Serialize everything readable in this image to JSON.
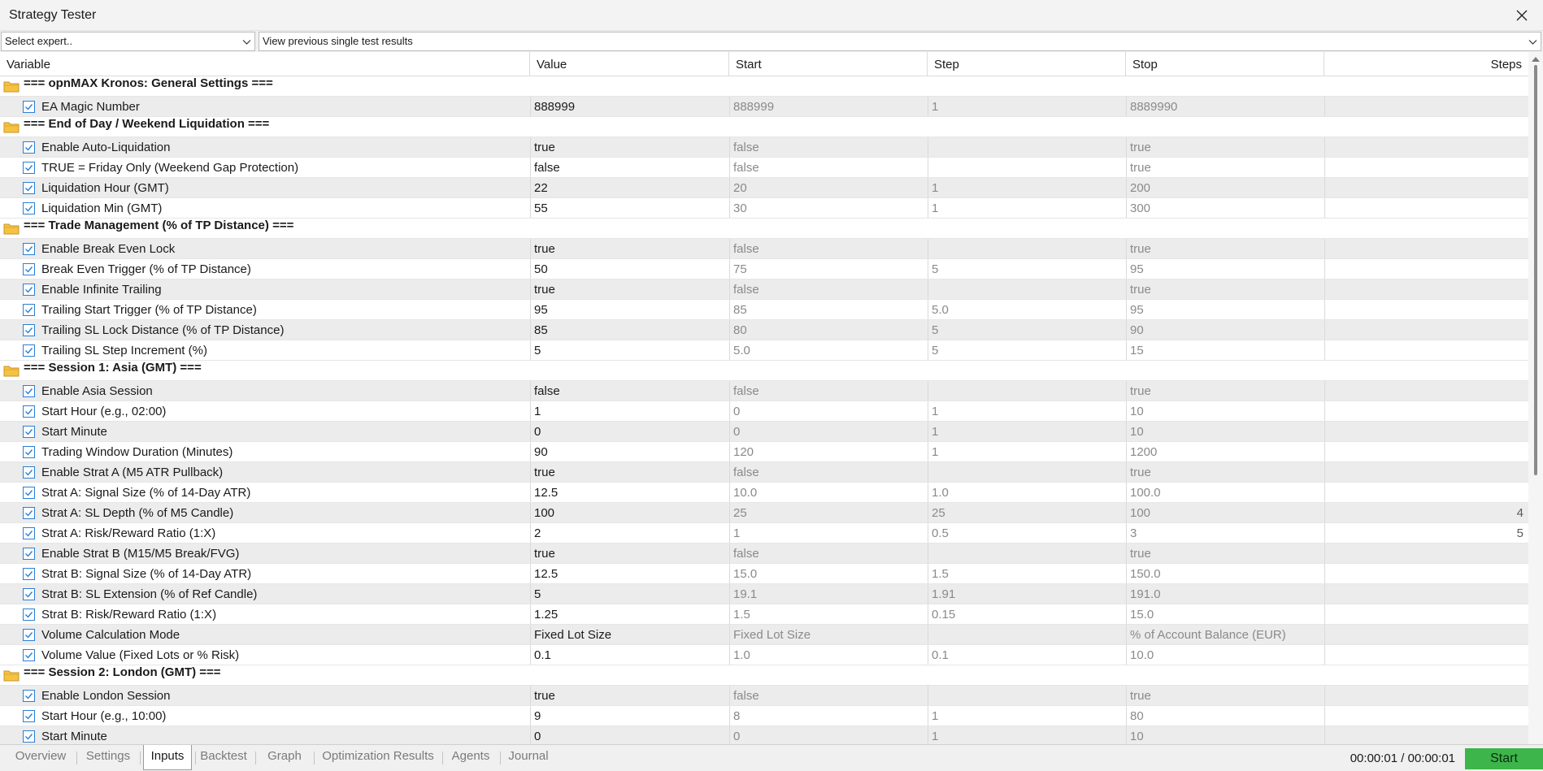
{
  "window": {
    "title": "Strategy Tester"
  },
  "toolbar": {
    "expert_value": "Select expert..",
    "history_value": "View previous single test results"
  },
  "columns": {
    "variable": "Variable",
    "value": "Value",
    "start": "Start",
    "step": "Step",
    "stop": "Stop",
    "steps": "Steps"
  },
  "rows": [
    {
      "type": "group",
      "label": "=== opnMAX Kronos: General Settings ==="
    },
    {
      "type": "param",
      "name": "EA Magic Number",
      "value": "888999",
      "start": "888999",
      "step": "1",
      "stop": "8889990",
      "steps": ""
    },
    {
      "type": "group",
      "label": "=== End of Day / Weekend Liquidation ==="
    },
    {
      "type": "param",
      "name": "Enable Auto-Liquidation",
      "value": "true",
      "start": "false",
      "step": "",
      "stop": "true",
      "steps": ""
    },
    {
      "type": "param",
      "name": "TRUE = Friday Only (Weekend Gap Protection)",
      "value": "false",
      "start": "false",
      "step": "",
      "stop": "true",
      "steps": ""
    },
    {
      "type": "param",
      "name": "Liquidation Hour (GMT)",
      "value": "22",
      "start": "20",
      "step": "1",
      "stop": "200",
      "steps": ""
    },
    {
      "type": "param",
      "name": "Liquidation Min (GMT)",
      "value": "55",
      "start": "30",
      "step": "1",
      "stop": "300",
      "steps": ""
    },
    {
      "type": "group",
      "label": "=== Trade Management (% of TP Distance) ==="
    },
    {
      "type": "param",
      "name": "Enable Break Even Lock",
      "value": "true",
      "start": "false",
      "step": "",
      "stop": "true",
      "steps": ""
    },
    {
      "type": "param",
      "name": "Break Even Trigger (% of TP Distance)",
      "value": "50",
      "start": "75",
      "step": "5",
      "stop": "95",
      "steps": ""
    },
    {
      "type": "param",
      "name": "Enable Infinite Trailing",
      "value": "true",
      "start": "false",
      "step": "",
      "stop": "true",
      "steps": ""
    },
    {
      "type": "param",
      "name": "Trailing Start Trigger (% of TP Distance)",
      "value": "95",
      "start": "85",
      "step": "5.0",
      "stop": "95",
      "steps": ""
    },
    {
      "type": "param",
      "name": "Trailing SL Lock Distance (% of TP Distance)",
      "value": "85",
      "start": "80",
      "step": "5",
      "stop": "90",
      "steps": ""
    },
    {
      "type": "param",
      "name": "Trailing SL Step Increment (%)",
      "value": "5",
      "start": "5.0",
      "step": "5",
      "stop": "15",
      "steps": ""
    },
    {
      "type": "group",
      "label": "=== Session 1: Asia (GMT) ==="
    },
    {
      "type": "param",
      "name": "Enable Asia Session",
      "value": "false",
      "start": "false",
      "step": "",
      "stop": "true",
      "steps": ""
    },
    {
      "type": "param",
      "name": "Start Hour (e.g., 02:00)",
      "value": "1",
      "start": "0",
      "step": "1",
      "stop": "10",
      "steps": ""
    },
    {
      "type": "param",
      "name": "Start Minute",
      "value": "0",
      "start": "0",
      "step": "1",
      "stop": "10",
      "steps": ""
    },
    {
      "type": "param",
      "name": "Trading Window Duration (Minutes)",
      "value": "90",
      "start": "120",
      "step": "1",
      "stop": "1200",
      "steps": ""
    },
    {
      "type": "param",
      "name": "Enable Strat A (M5 ATR Pullback)",
      "value": "true",
      "start": "false",
      "step": "",
      "stop": "true",
      "steps": ""
    },
    {
      "type": "param",
      "name": "Strat A: Signal Size (% of 14-Day ATR)",
      "value": "12.5",
      "start": "10.0",
      "step": "1.0",
      "stop": "100.0",
      "steps": ""
    },
    {
      "type": "param",
      "name": "Strat A: SL Depth (% of M5 Candle)",
      "value": "100",
      "start": "25",
      "step": "25",
      "stop": "100",
      "steps": "4"
    },
    {
      "type": "param",
      "name": "Strat A: Risk/Reward Ratio (1:X)",
      "value": "2",
      "start": "1",
      "step": "0.5",
      "stop": "3",
      "steps": "5"
    },
    {
      "type": "param",
      "name": "Enable Strat B (M15/M5 Break/FVG)",
      "value": "true",
      "start": "false",
      "step": "",
      "stop": "true",
      "steps": ""
    },
    {
      "type": "param",
      "name": "Strat B: Signal Size (% of 14-Day ATR)",
      "value": "12.5",
      "start": "15.0",
      "step": "1.5",
      "stop": "150.0",
      "steps": ""
    },
    {
      "type": "param",
      "name": "Strat B: SL Extension (% of Ref Candle)",
      "value": "5",
      "start": "19.1",
      "step": "1.91",
      "stop": "191.0",
      "steps": ""
    },
    {
      "type": "param",
      "name": "Strat B: Risk/Reward Ratio (1:X)",
      "value": "1.25",
      "start": "1.5",
      "step": "0.15",
      "stop": "15.0",
      "steps": ""
    },
    {
      "type": "param",
      "name": "Volume Calculation Mode",
      "value": "Fixed Lot Size",
      "start": "Fixed Lot Size",
      "step": "",
      "stop": "% of Account Balance (EUR)",
      "steps": ""
    },
    {
      "type": "param",
      "name": "Volume Value (Fixed Lots or % Risk)",
      "value": "0.1",
      "start": "1.0",
      "step": "0.1",
      "stop": "10.0",
      "steps": ""
    },
    {
      "type": "group",
      "label": "=== Session 2: London (GMT) ==="
    },
    {
      "type": "param",
      "name": "Enable London Session",
      "value": "true",
      "start": "false",
      "step": "",
      "stop": "true",
      "steps": ""
    },
    {
      "type": "param",
      "name": "Start Hour (e.g., 10:00)",
      "value": "9",
      "start": "8",
      "step": "1",
      "stop": "80",
      "steps": ""
    },
    {
      "type": "param",
      "name": "Start Minute",
      "value": "0",
      "start": "0",
      "step": "1",
      "stop": "10",
      "steps": ""
    }
  ],
  "tabs": [
    {
      "label": "Overview",
      "active": false
    },
    {
      "label": "Settings",
      "active": false
    },
    {
      "label": "Inputs",
      "active": true
    },
    {
      "label": "Backtest",
      "active": false
    },
    {
      "label": "Graph",
      "active": false
    },
    {
      "label": "Optimization Results",
      "active": false
    },
    {
      "label": "Agents",
      "active": false
    },
    {
      "label": "Journal",
      "active": false
    }
  ],
  "status": {
    "timer": "00:00:01 / 00:00:01",
    "start_label": "Start"
  },
  "colors": {
    "accent_blue": "#2b7fd6",
    "start_green": "#3db54a",
    "folder_yellow": "#f5c242",
    "row_stripe": "#ececec"
  },
  "icons": {
    "group": "folder-icon",
    "param": "checkbox-checked-icon",
    "close": "close-icon",
    "dropdown": "chevron-down-icon"
  }
}
